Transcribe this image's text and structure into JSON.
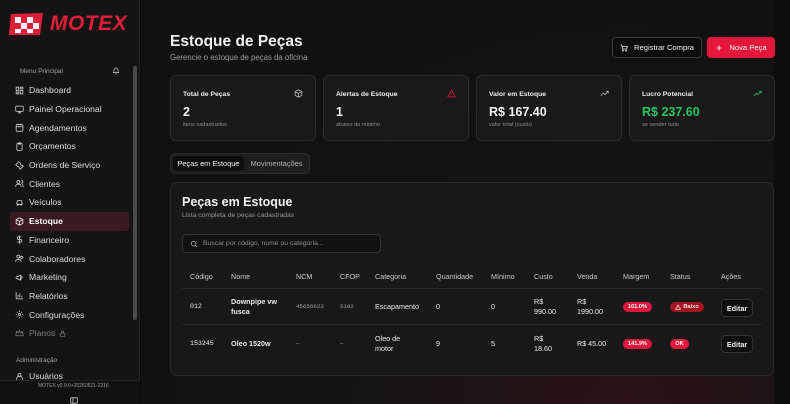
{
  "app": {
    "brand": "MOTEX",
    "version": "MOTEX v0.0.0+20260521-2216"
  },
  "sidebar": {
    "section_title": "Menu Principal",
    "items": [
      {
        "label": "Dashboard",
        "icon": "layout-dashboard-icon"
      },
      {
        "label": "Painel Operacional",
        "icon": "monitor-icon"
      },
      {
        "label": "Agendamentos",
        "icon": "calendar-icon"
      },
      {
        "label": "Orçamentos",
        "icon": "clipboard-icon"
      },
      {
        "label": "Ordens de Serviço",
        "icon": "wrench-icon"
      },
      {
        "label": "Clientes",
        "icon": "users-icon"
      },
      {
        "label": "Veículos",
        "icon": "car-icon"
      },
      {
        "label": "Estoque",
        "icon": "package-icon",
        "active": true
      },
      {
        "label": "Financeiro",
        "icon": "dollar-icon"
      },
      {
        "label": "Colaboradores",
        "icon": "user-group-icon"
      },
      {
        "label": "Marketing",
        "icon": "megaphone-icon"
      },
      {
        "label": "Relatórios",
        "icon": "chart-icon"
      },
      {
        "label": "Configurações",
        "icon": "gear-icon"
      },
      {
        "label": "Planos",
        "icon": "crown-icon",
        "disabled": true
      }
    ],
    "admin_title": "Administração",
    "admin_items": [
      {
        "label": "Usuários",
        "icon": "user-icon"
      }
    ]
  },
  "header": {
    "title": "Estoque de Peças",
    "subtitle": "Gerencie o estoque de peças da oficina",
    "register_purchase": "Registrar Compra",
    "new_part": "Nova Peça"
  },
  "stats": [
    {
      "title": "Total de Peças",
      "value": "2",
      "sub": "itens cadastrados",
      "icon": "package-icon"
    },
    {
      "title": "Alertas de Estoque",
      "value": "1",
      "sub": "abaixo do mínimo",
      "icon": "warning-icon"
    },
    {
      "title": "Valor em Estoque",
      "value": "R$ 167.40",
      "sub": "valor total (custo)",
      "icon": "trending-up-icon"
    },
    {
      "title": "Lucro Potencial",
      "value": "R$ 237.60",
      "sub": "se vender tudo",
      "icon": "trending-up-icon",
      "value_color": "#26c55e"
    }
  ],
  "tabs": [
    {
      "label": "Peças em Estoque",
      "active": true
    },
    {
      "label": "Movimentações",
      "active": false
    }
  ],
  "panel": {
    "title": "Peças em Estoque",
    "subtitle": "Lista completa de peças cadastradas",
    "search_placeholder": "Buscar por código, nome ou categoria..."
  },
  "table": {
    "columns": [
      "Código",
      "Nome",
      "NCM",
      "CFOP",
      "Categoria",
      "Quantidade",
      "Mínimo",
      "Custo",
      "Venda",
      "Margem",
      "Status",
      "Ações"
    ],
    "rows": [
      {
        "codigo": "012",
        "nome": "Downpipe vw fusca",
        "ncm": "45656622",
        "cfop": "5102",
        "categoria": "Escapamento",
        "quantidade": "0",
        "minimo": "0",
        "custo": "R$ 990.00",
        "venda": "R$ 1990.00",
        "margem": "101.0%",
        "status": "Baixo",
        "acao": "Editar"
      },
      {
        "codigo": "153245",
        "nome": "Oleo 1520w",
        "ncm": "—",
        "cfop": "—",
        "categoria": "Oleo de motor",
        "quantidade": "9",
        "minimo": "5",
        "custo": "R$ 18.60",
        "venda": "R$ 45.00",
        "margem": "141.9%",
        "status": "OK",
        "acao": "Editar"
      }
    ]
  },
  "colors": {
    "accent": "#e4173a",
    "positive": "#26c55e",
    "background": "#111112"
  }
}
